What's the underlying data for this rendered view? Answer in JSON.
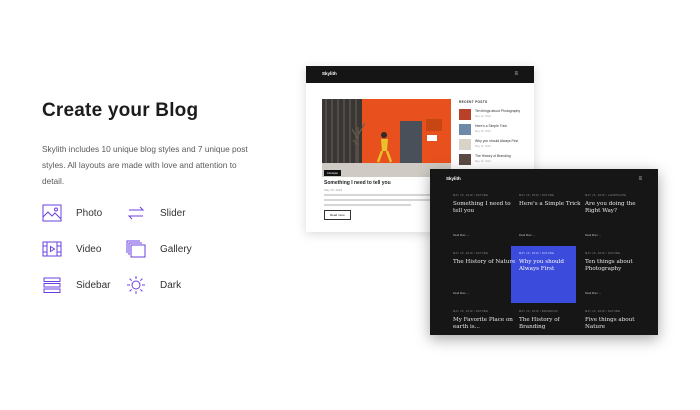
{
  "heading": "Create your Blog",
  "intro": "Skylith includes 10 unique blog styles and 7 unique post styles. All layouts are made with love and attention to detail.",
  "colors": {
    "accent": "#6a3fe0",
    "dark_bg": "#161616",
    "highlight_card": "#3b4bdb",
    "hero_wall": "#e8501e"
  },
  "features": [
    {
      "label": "Photo",
      "icon": "photo-icon"
    },
    {
      "label": "Slider",
      "icon": "slider-icon"
    },
    {
      "label": "Video",
      "icon": "video-icon"
    },
    {
      "label": "Gallery",
      "icon": "gallery-icon"
    },
    {
      "label": "Sidebar",
      "icon": "sidebar-icon"
    },
    {
      "label": "Dark",
      "icon": "sun-icon"
    }
  ],
  "light_preview": {
    "logo": "Skylith",
    "post_tag": "Lifestyle",
    "post_title": "Something I need to tell you",
    "post_meta": "May 16, 2019",
    "read_more": "Read more",
    "recent_heading": "RECENT POSTS",
    "recent": [
      {
        "title": "Ten things about Photography",
        "meta": "May 16, 2019"
      },
      {
        "title": "Here's a Simple Trick",
        "meta": "May 16, 2019"
      },
      {
        "title": "Why you should Always First",
        "meta": "May 16, 2019"
      },
      {
        "title": "The History of Branding",
        "meta": "May 16, 2019"
      }
    ]
  },
  "dark_preview": {
    "logo": "Skylith",
    "read_more": "Read More →",
    "posts": [
      {
        "meta": "MAY 16, 2019 / NATURE",
        "title": "Something I need to tell you"
      },
      {
        "meta": "MAY 16, 2019 / NATURE",
        "title": "Here's a Simple Trick"
      },
      {
        "meta": "MAY 16, 2019 / LANDSCAPE",
        "title": "Are you doing the Right Way?"
      },
      {
        "meta": "MAY 16, 2019 / NATURE",
        "title": "The History of Nature"
      },
      {
        "meta": "MAY 16, 2019 / NATURE",
        "title": "Why you should Always First"
      },
      {
        "meta": "MAY 16, 2019 / NATURE",
        "title": "Ten things about Photography"
      },
      {
        "meta": "MAY 16, 2019 / NATURE",
        "title": "My Favorite Place on earth is..."
      },
      {
        "meta": "MAY 16, 2019 / BRANDING",
        "title": "The History of Branding"
      },
      {
        "meta": "MAY 16, 2019 / NATURE",
        "title": "Five things about Nature"
      }
    ]
  }
}
